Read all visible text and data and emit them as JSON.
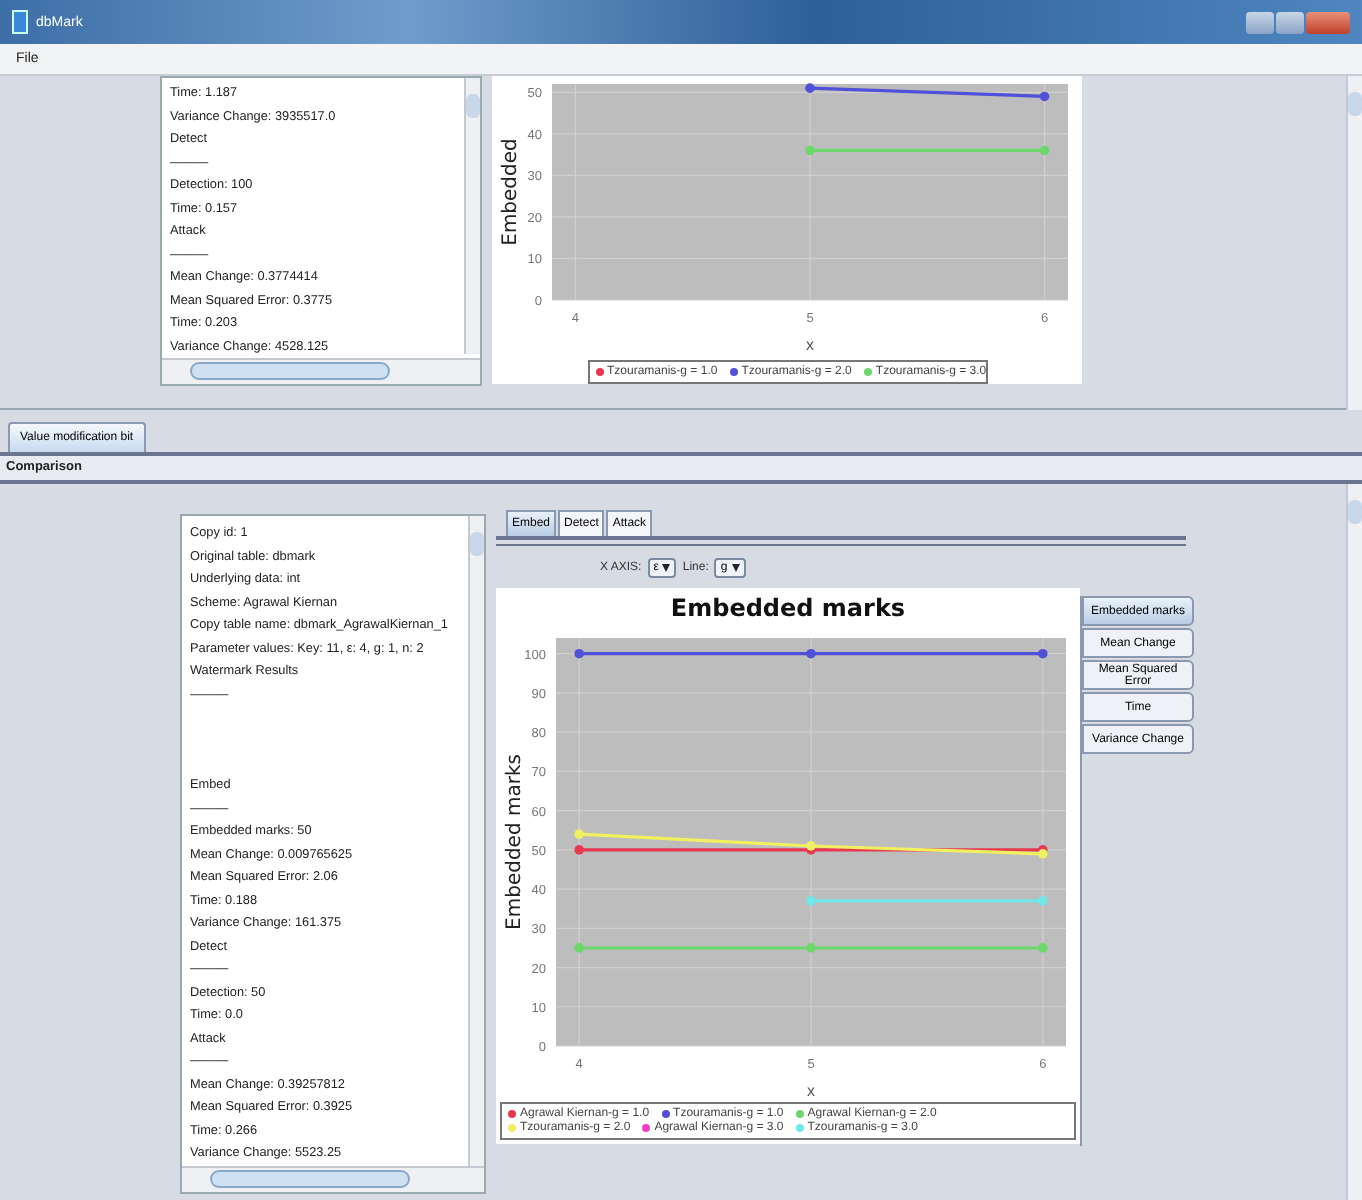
{
  "window": {
    "title": "dbMark"
  },
  "menu": [
    "File"
  ],
  "top_panel": {
    "log_lines": [
      "Time: 1.187",
      "Variance Change: 3935517.0",
      "Detect",
      "———",
      "Detection: 100",
      "Time: 0.157",
      "Attack",
      "———",
      "Mean Change: 0.3774414",
      "Mean Squared Error: 0.3775",
      "Time: 0.203",
      "Variance Change: 4528.125"
    ],
    "chart": {
      "chart_data": {
        "type": "line",
        "xlabel": "x",
        "ylabel": "Embedded",
        "x": [
          5,
          6
        ],
        "xticks": [
          4,
          5,
          6
        ],
        "xlim": [
          3.9,
          6.1
        ],
        "yticks": [
          0,
          10,
          20,
          30,
          40,
          50
        ],
        "ylim": [
          0,
          52
        ],
        "grid": true,
        "legend": "bottom",
        "series": [
          {
            "name": "Tzouramanis-g = 1.0",
            "color": "#e8384f",
            "marker": "circle",
            "values": [
              null,
              null
            ]
          },
          {
            "name": "Tzouramanis-g = 2.0",
            "color": "#5050d8",
            "marker": "circle",
            "values": [
              51,
              49
            ]
          },
          {
            "name": "Tzouramanis-g = 3.0",
            "color": "#6cd86c",
            "marker": "circle",
            "values": [
              36,
              36
            ]
          }
        ]
      }
    }
  },
  "tabs": [
    {
      "label": "Value modification bit",
      "selected": true
    }
  ],
  "section_title": "Comparison",
  "comparison": {
    "log_blocks": [
      [
        "Copy id: 1",
        "Original table: dbmark",
        "Underlying data: int",
        "Scheme: Agrawal Kiernan",
        "Copy table name: dbmark_AgrawalKiernan_1",
        "Parameter values: Key: 11, ε: 4, g: 1, n: 2",
        "Watermark Results",
        "———"
      ],
      [
        "Embed",
        "———",
        "Embedded marks: 50",
        "Mean Change: 0.009765625",
        "Mean Squared Error: 2.06",
        "Time: 0.188",
        "Variance Change: 161.375",
        "Detect",
        "———",
        "Detection: 50",
        "Time: 0.0",
        "Attack",
        "———",
        "Mean Change: 0.39257812",
        "Mean Squared Error: 0.3925",
        "Time: 0.266",
        "Variance Change: 5523.25"
      ]
    ],
    "view_tabs": [
      {
        "label": "Embed",
        "selected": true
      },
      {
        "label": "Detect",
        "selected": false
      },
      {
        "label": "Attack",
        "selected": false
      }
    ],
    "x_axis": {
      "label": "X AXIS:",
      "value": "ε"
    },
    "line": {
      "label": "Line:",
      "value": "g"
    },
    "chart": {
      "chart_data": {
        "type": "line",
        "title": "Embedded marks",
        "xlabel": "x",
        "ylabel": "Embedded marks",
        "x": [
          4,
          5,
          6
        ],
        "xticks": [
          4,
          5,
          6
        ],
        "xlim": [
          3.9,
          6.1
        ],
        "yticks": [
          0,
          10,
          20,
          30,
          40,
          50,
          60,
          70,
          80,
          90,
          100
        ],
        "ylim": [
          0,
          104
        ],
        "grid": true,
        "legend": "bottom",
        "series": [
          {
            "name": "Agrawal Kiernan-g = 1.0",
            "color": "#e8384f",
            "marker": "circle",
            "values": [
              50,
              50,
              50
            ]
          },
          {
            "name": "Tzouramanis-g = 1.0",
            "color": "#5050d8",
            "marker": "circle",
            "values": [
              100,
              100,
              100
            ]
          },
          {
            "name": "Agrawal Kiernan-g = 2.0",
            "color": "#6cd86c",
            "marker": "circle",
            "values": [
              25,
              25,
              25
            ]
          },
          {
            "name": "Tzouramanis-g = 2.0",
            "color": "#f0f060",
            "marker": "circle",
            "values": [
              54,
              51,
              49
            ]
          },
          {
            "name": "Agrawal Kiernan-g = 3.0",
            "color": "#f040c0",
            "marker": "circle",
            "values": [
              null,
              null,
              null
            ]
          },
          {
            "name": "Tzouramanis-g = 3.0",
            "color": "#70e8e8",
            "marker": "circle",
            "values": [
              null,
              37,
              37
            ]
          }
        ]
      }
    },
    "metric_buttons": [
      {
        "label": "Embedded marks",
        "selected": true
      },
      {
        "label": "Mean Change",
        "selected": false
      },
      {
        "label": "Mean Squared Error",
        "selected": false
      },
      {
        "label": "Time",
        "selected": false
      },
      {
        "label": "Variance Change",
        "selected": false
      }
    ]
  }
}
